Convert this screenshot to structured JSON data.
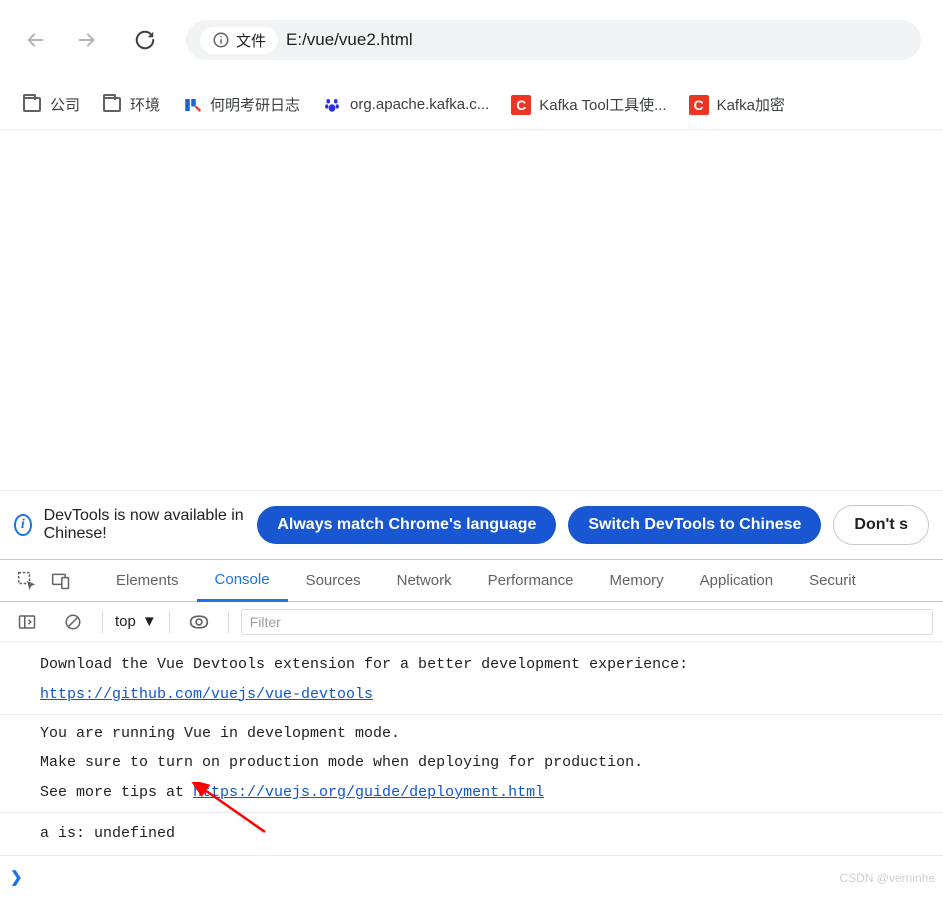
{
  "toolbar": {
    "file_label": "文件",
    "url": "E:/vue/vue2.html"
  },
  "bookmarks": [
    {
      "type": "folder",
      "label": "公司"
    },
    {
      "type": "folder",
      "label": "环境"
    },
    {
      "type": "blue",
      "label": "何明考研日志"
    },
    {
      "type": "paw",
      "label": "org.apache.kafka.c..."
    },
    {
      "type": "c",
      "label": "Kafka Tool工具使..."
    },
    {
      "type": "c",
      "label": "Kafka加密"
    }
  ],
  "banner": {
    "text": "DevTools is now available in Chinese!",
    "match_btn": "Always match Chrome's language",
    "switch_btn": "Switch DevTools to Chinese",
    "dont_btn": "Don't s"
  },
  "tabs": {
    "elements": "Elements",
    "console": "Console",
    "sources": "Sources",
    "network": "Network",
    "performance": "Performance",
    "memory": "Memory",
    "application": "Application",
    "security": "Securit"
  },
  "console_bar": {
    "context": "top",
    "filter_placeholder": "Filter"
  },
  "console_messages": {
    "msg1_line1": "Download the Vue Devtools extension for a better development experience:",
    "msg1_link": "https://github.com/vuejs/vue-devtools",
    "msg2_line1": "You are running Vue in development mode.",
    "msg2_line2": "Make sure to turn on production mode when deploying for production.",
    "msg2_line3_prefix": "See more tips at ",
    "msg2_link": "https://vuejs.org/guide/deployment.html",
    "msg3": "a is: undefined"
  },
  "prompt_symbol": "❯",
  "watermark": "CSDN @verninhe"
}
